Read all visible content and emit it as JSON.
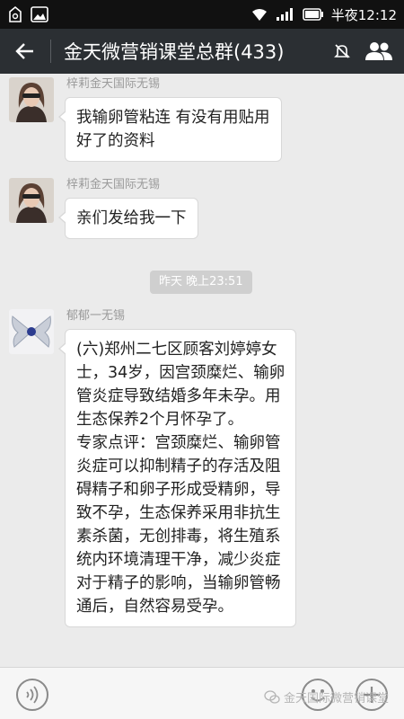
{
  "status_bar": {
    "time": "半夜12:12"
  },
  "header": {
    "title": "金天微营销课堂总群(433)"
  },
  "messages": [
    {
      "sender": "梓莉金天国际无锡",
      "lines": [
        "我输卵管粘连 有没有用贴用",
        "好了的资料"
      ]
    },
    {
      "sender": "梓莉金天国际无锡",
      "lines": [
        "亲们发给我一下"
      ]
    },
    {
      "sender": "郁郁一无锡",
      "lines": [
        "(六)郑州二七区顾客刘婷婷女",
        "士，34岁，因宫颈糜烂、输卵",
        "管炎症导致结婚多年未孕。用",
        "生态保养2个月怀孕了。",
        "专家点评：宫颈糜烂、输卵管",
        "炎症可以抑制精子的存活及阻",
        "碍精子和卵子形成受精卵，导",
        "致不孕，生态保养采用非抗生",
        "素杀菌，无创排毒，将生殖系",
        "统内环境清理干净，减少炎症",
        "对于精子的影响，当输卵管畅",
        "通后，自然容易受孕。"
      ]
    }
  ],
  "timestamp": "昨天 晚上23:51",
  "watermark": "金天国际微营销课堂"
}
